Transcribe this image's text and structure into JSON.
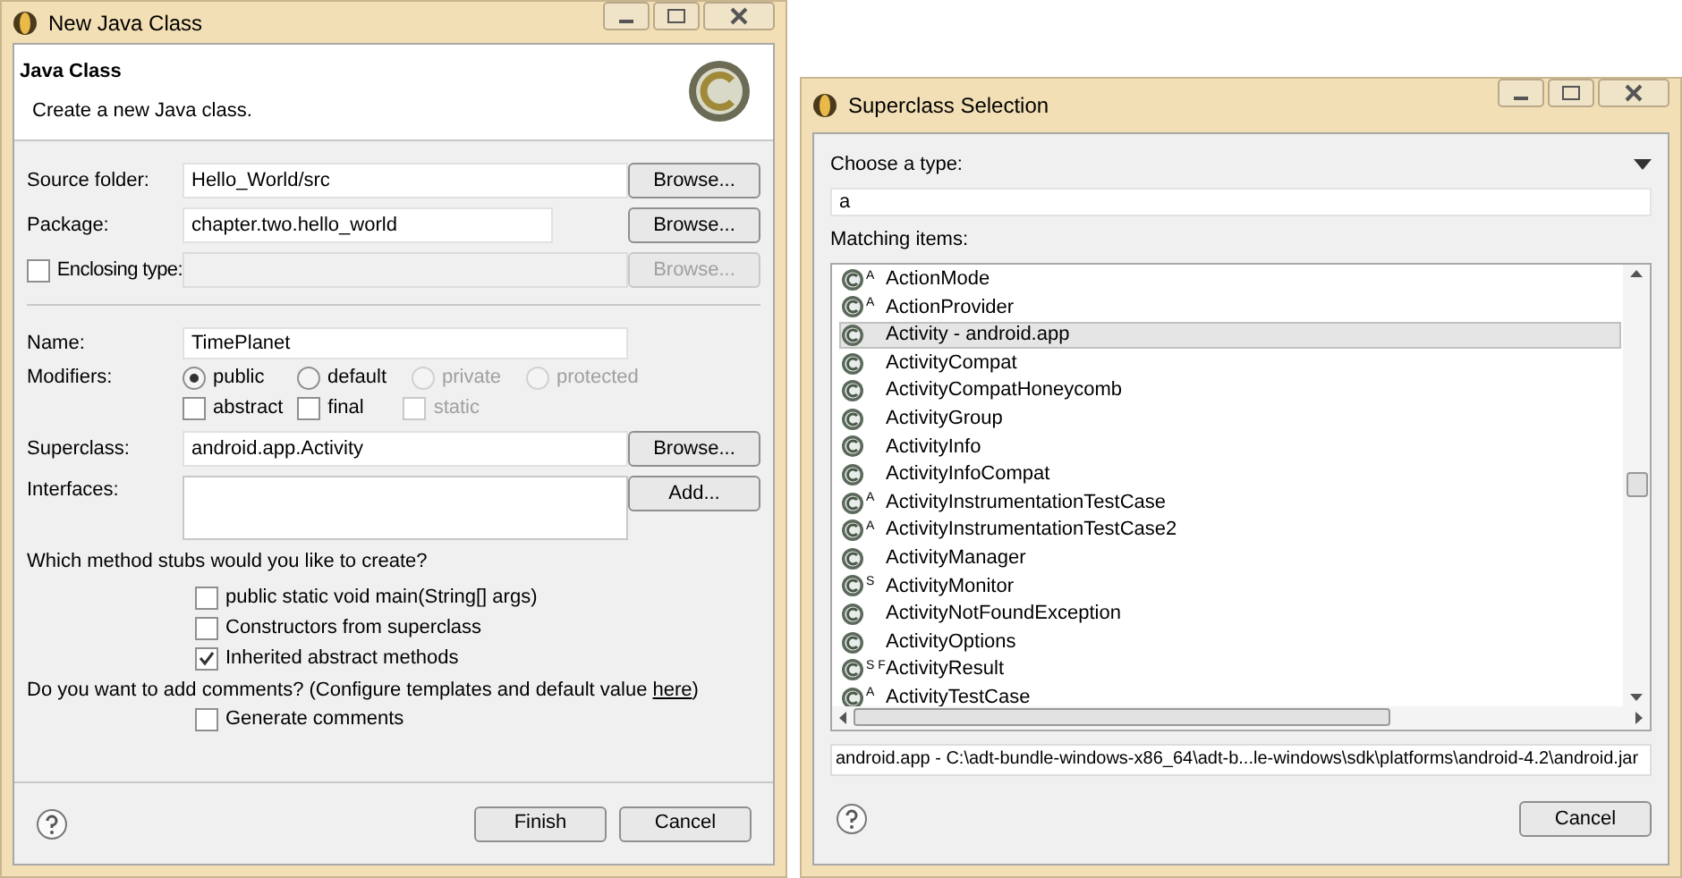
{
  "left": {
    "title": "New Java Class",
    "header_title": "Java Class",
    "header_subtitle": "Create a new Java class.",
    "source_folder": {
      "label": "Source folder:",
      "value": "Hello_World/src",
      "button": "Browse..."
    },
    "package": {
      "label": "Package:",
      "value": "chapter.two.hello_world",
      "button": "Browse..."
    },
    "enclosing_type": {
      "label": "Enclosing type:",
      "checked": false,
      "button": "Browse...",
      "disabled": true
    },
    "name": {
      "label": "Name:",
      "value": "TimePlanet"
    },
    "modifiers": {
      "label": "Modifiers:",
      "options": [
        {
          "label": "public",
          "selected": true,
          "disabled": false
        },
        {
          "label": "default",
          "selected": false,
          "disabled": false
        },
        {
          "label": "private",
          "selected": false,
          "disabled": true
        },
        {
          "label": "protected",
          "selected": false,
          "disabled": true
        }
      ],
      "flags": [
        {
          "label": "abstract",
          "checked": false,
          "disabled": false
        },
        {
          "label": "final",
          "checked": false,
          "disabled": false
        },
        {
          "label": "static",
          "checked": false,
          "disabled": true
        }
      ]
    },
    "superclass": {
      "label": "Superclass:",
      "value": "android.app.Activity",
      "button": "Browse..."
    },
    "interfaces": {
      "label": "Interfaces:",
      "button": "Add..."
    },
    "stubs": {
      "question": "Which method stubs would you like to create?",
      "options": [
        {
          "label": "public static void main(String[] args)",
          "checked": false
        },
        {
          "label": "Constructors from superclass",
          "checked": false
        },
        {
          "label": "Inherited abstract methods",
          "checked": true
        }
      ]
    },
    "comments": {
      "question": "Do you want to add comments? (Configure templates and default value ",
      "link": "here",
      "question_end": ")",
      "options": [
        {
          "label": "Generate comments",
          "checked": false
        }
      ]
    },
    "buttons": [
      "Finish",
      "Cancel"
    ]
  },
  "right": {
    "title": "Superclass Selection",
    "type_label": "Choose a type:",
    "filter": "a",
    "matching_label": "Matching items:",
    "items": [
      {
        "label": "ActionMode",
        "badge": "A",
        "selected": false
      },
      {
        "label": "ActionProvider",
        "badge": "A",
        "selected": false
      },
      {
        "label": "Activity - android.app",
        "selected": true
      },
      {
        "label": "ActivityCompat",
        "selected": false
      },
      {
        "label": "ActivityCompatHoneycomb",
        "selected": false
      },
      {
        "label": "ActivityGroup",
        "selected": false
      },
      {
        "label": "ActivityInfo",
        "selected": false
      },
      {
        "label": "ActivityInfoCompat",
        "selected": false
      },
      {
        "label": "ActivityInstrumentationTestCase",
        "badge": "A",
        "selected": false
      },
      {
        "label": "ActivityInstrumentationTestCase2",
        "badge": "A",
        "selected": false
      },
      {
        "label": "ActivityManager",
        "selected": false
      },
      {
        "label": "ActivityMonitor",
        "badge": "S",
        "selected": false
      },
      {
        "label": "ActivityNotFoundException",
        "selected": false
      },
      {
        "label": "ActivityOptions",
        "selected": false
      },
      {
        "label": "ActivityResult",
        "badge": "S F",
        "selected": false
      },
      {
        "label": "ActivityTestCase",
        "badge": "A",
        "selected": false
      }
    ],
    "path": "android.app - C:\\adt-bundle-windows-x86_64\\adt-b...le-windows\\sdk\\platforms\\android-4.2\\android.jar",
    "buttons": [
      "Cancel"
    ]
  }
}
